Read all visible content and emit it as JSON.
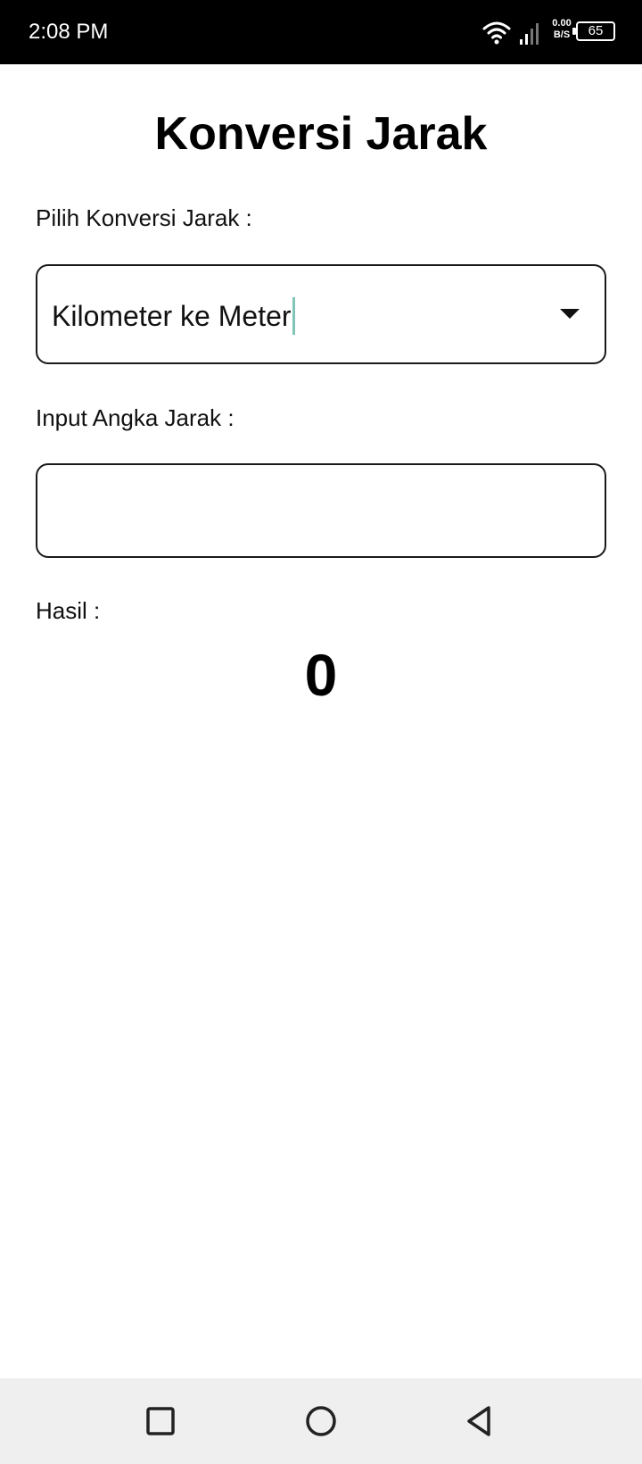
{
  "status_bar": {
    "time": "2:08 PM",
    "net_speed_value": "0.00",
    "net_speed_unit": "B/S",
    "battery": "65"
  },
  "page": {
    "title": "Konversi Jarak",
    "select_label": "Pilih Konversi Jarak :",
    "select_value": "Kilometer ke Meter",
    "input_label": "Input Angka Jarak :",
    "input_value": "",
    "result_label": "Hasil :",
    "result_value": "0"
  },
  "icons": {
    "dropdown": "chevron-down-icon",
    "wifi": "wifi-icon",
    "signal": "signal-icon",
    "battery": "battery-icon",
    "recents": "square-icon",
    "home": "circle-icon",
    "back": "triangle-back-icon"
  },
  "colors": {
    "status_bar": "#000000",
    "nav_bar": "#efefef",
    "text_cursor": "#7fc6b8",
    "border": "#1a1a1a"
  }
}
